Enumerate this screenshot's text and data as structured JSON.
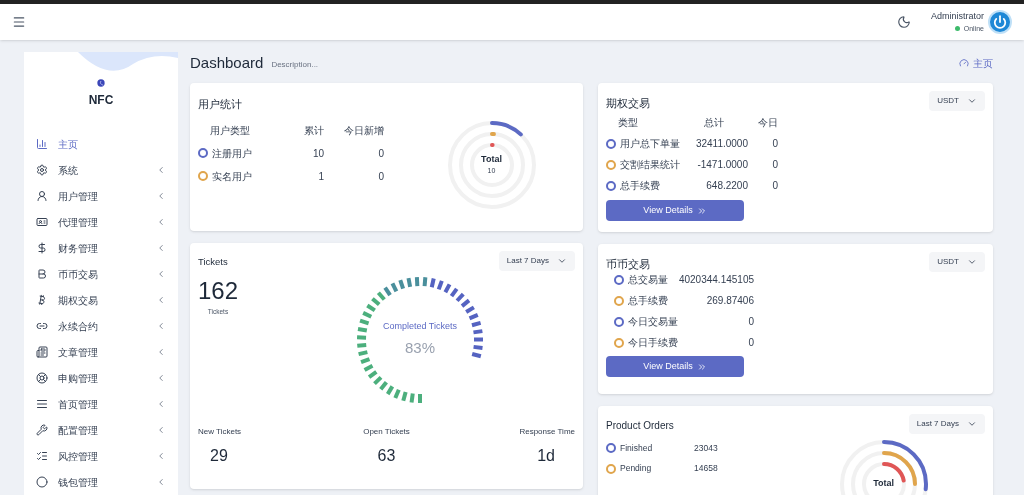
{
  "header": {
    "user_name": "Administrator",
    "status": "Online"
  },
  "sidebar": {
    "brand": "NFC",
    "items": [
      {
        "label": "主页",
        "selected": true,
        "expandable": false
      },
      {
        "label": "系统",
        "selected": false,
        "expandable": true
      },
      {
        "label": "用户管理",
        "selected": false,
        "expandable": true
      },
      {
        "label": "代理管理",
        "selected": false,
        "expandable": true
      },
      {
        "label": "财务管理",
        "selected": false,
        "expandable": true
      },
      {
        "label": "币币交易",
        "selected": false,
        "expandable": true
      },
      {
        "label": "期权交易",
        "selected": false,
        "expandable": true
      },
      {
        "label": "永续合约",
        "selected": false,
        "expandable": true
      },
      {
        "label": "文章管理",
        "selected": false,
        "expandable": true
      },
      {
        "label": "申购管理",
        "selected": false,
        "expandable": true
      },
      {
        "label": "首页管理",
        "selected": false,
        "expandable": true
      },
      {
        "label": "配置管理",
        "selected": false,
        "expandable": true
      },
      {
        "label": "风控管理",
        "selected": false,
        "expandable": true
      },
      {
        "label": "钱包管理",
        "selected": false,
        "expandable": true
      }
    ]
  },
  "page": {
    "title": "Dashboard",
    "description": "Description...",
    "breadcrumb": "主页"
  },
  "user_stats": {
    "title": "用户统计",
    "columns": [
      "用户类型",
      "累计",
      "今日新增"
    ],
    "rows": [
      {
        "label": "注册用户",
        "total": "10",
        "today": "0",
        "color": "#5c6ac4"
      },
      {
        "label": "实名用户",
        "total": "1",
        "today": "0",
        "color": "#e0a54c"
      }
    ],
    "chart_label": "Total",
    "chart_value": "10"
  },
  "options_trading": {
    "title": "期权交易",
    "currency": "USDT",
    "columns": [
      "类型",
      "总计",
      "今日"
    ],
    "rows": [
      {
        "label": "用户总下单量",
        "total": "32411.0000",
        "today": "0",
        "color": "#5c6ac4"
      },
      {
        "label": "交割结果统计",
        "total": "-1471.0000",
        "today": "0",
        "color": "#e0a54c"
      },
      {
        "label": "总手续费",
        "total": "648.2200",
        "today": "0",
        "color": "#5c6ac4"
      }
    ],
    "button": "View Details"
  },
  "tickets": {
    "title": "Tickets",
    "range": "Last 7 Days",
    "count": "162",
    "count_label": "Tickets",
    "gauge_label": "Completed Tickets",
    "gauge_value": "83%",
    "stats": [
      {
        "label": "New Tickets",
        "value": "29"
      },
      {
        "label": "Open Tickets",
        "value": "63"
      },
      {
        "label": "Response Time",
        "value": "1d"
      }
    ]
  },
  "spot_trading": {
    "title": "币币交易",
    "currency": "USDT",
    "rows": [
      {
        "label": "总交易量",
        "value": "4020344.145105",
        "color": "#5c6ac4"
      },
      {
        "label": "总手续费",
        "value": "269.87406",
        "color": "#e0a54c"
      },
      {
        "label": "今日交易量",
        "value": "0",
        "color": "#5c6ac4"
      },
      {
        "label": "今日手续费",
        "value": "0",
        "color": "#e0a54c"
      }
    ],
    "button": "View Details"
  },
  "product_orders": {
    "title": "Product Orders",
    "range": "Last 7 Days",
    "rows": [
      {
        "label": "Finished",
        "value": "23043",
        "color": "#5c6ac4"
      },
      {
        "label": "Pending",
        "value": "14658",
        "color": "#e0a54c"
      }
    ],
    "chart_label": "Total"
  }
}
